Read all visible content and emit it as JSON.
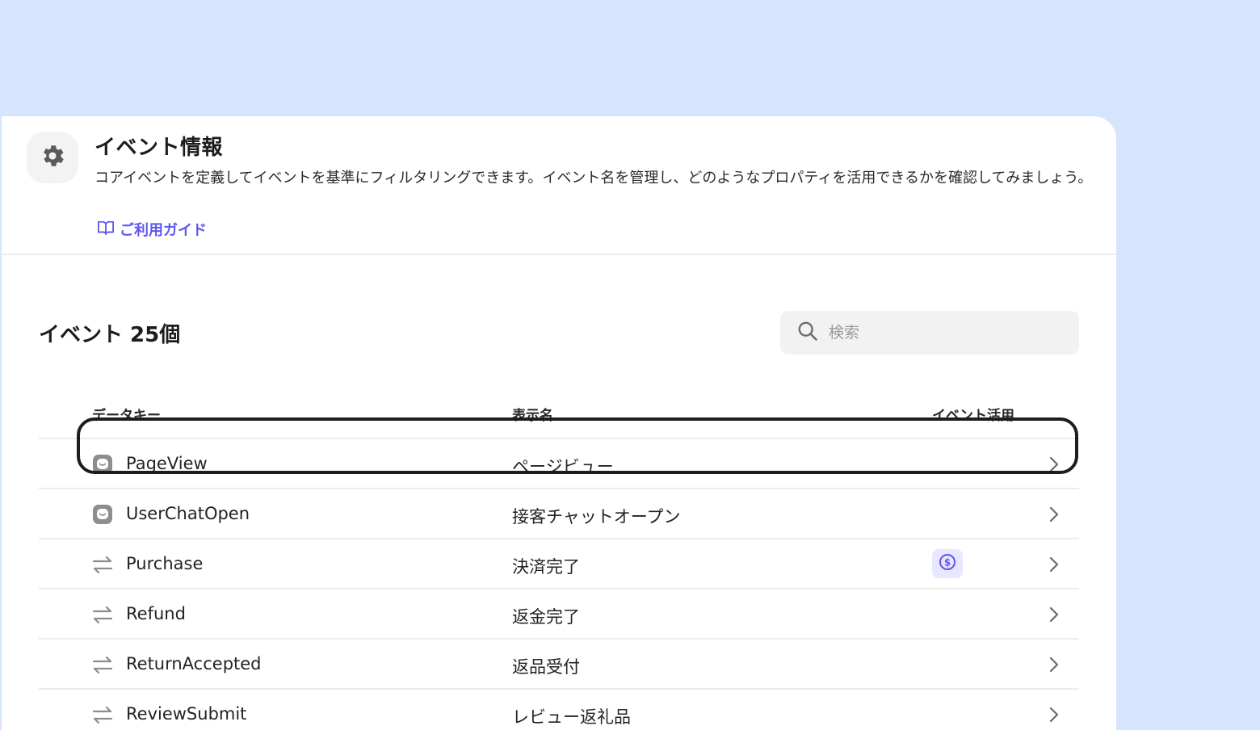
{
  "header": {
    "title": "イベント情報",
    "description": "コアイベントを定義してイベントを基準にフィルタリングできます。イベント名を管理し、どのようなプロパティを活用できるかを確認してみましょう。",
    "guide_link": "ご利用ガイド"
  },
  "list": {
    "count_title": "イベント 25個",
    "search_placeholder": "検索",
    "columns": {
      "data_key": "データキー",
      "display_name": "表示名",
      "usage": "イベント活用"
    },
    "rows": [
      {
        "key": "PageView",
        "display": "ページビュー",
        "icon": "channel-chat-icon",
        "usage_icon": null
      },
      {
        "key": "UserChatOpen",
        "display": "接客チャットオープン",
        "icon": "channel-chat-icon",
        "usage_icon": null
      },
      {
        "key": "Purchase",
        "display": "決済完了",
        "icon": "sync-arrows-icon",
        "usage_icon": "dollar-coin-icon"
      },
      {
        "key": "Refund",
        "display": "返金完了",
        "icon": "sync-arrows-icon",
        "usage_icon": null
      },
      {
        "key": "ReturnAccepted",
        "display": "返品受付",
        "icon": "sync-arrows-icon",
        "usage_icon": null
      },
      {
        "key": "ReviewSubmit",
        "display": "レビュー返礼品",
        "icon": "sync-arrows-icon",
        "usage_icon": null
      }
    ]
  },
  "colors": {
    "background": "#d6e4fe",
    "accent": "#5e56f0",
    "usage_badge": "#e9e7ff",
    "highlight_border": "#1d1d1d"
  }
}
